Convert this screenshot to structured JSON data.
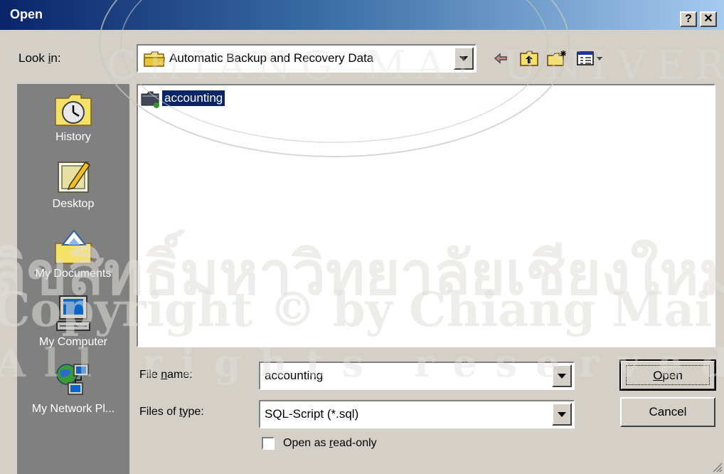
{
  "window": {
    "title": "Open",
    "help_label": "?",
    "close_label": "✕"
  },
  "lookin": {
    "label_pre": "Look ",
    "label_u": "i",
    "label_post": "n:",
    "value": "Automatic Backup and Recovery Data"
  },
  "toolbar": {
    "back_icon": "back-arrow-icon",
    "up_icon": "up-folder-icon",
    "newfolder_icon": "new-folder-icon",
    "view_icon": "view-menu-icon"
  },
  "places": [
    {
      "label": "History",
      "icon": "history-icon"
    },
    {
      "label": "Desktop",
      "icon": "desktop-icon"
    },
    {
      "label": "My Documents",
      "icon": "my-documents-icon"
    },
    {
      "label": "My Computer",
      "icon": "my-computer-icon"
    },
    {
      "label": "My Network Pl...",
      "icon": "my-network-places-icon"
    }
  ],
  "files": [
    {
      "name": "accounting",
      "icon": "database-folder-icon",
      "selected": true
    }
  ],
  "filename": {
    "label_pre": "File ",
    "label_u": "n",
    "label_post": "ame:",
    "value": "accounting"
  },
  "filetype": {
    "label_pre": "Files of ",
    "label_u": "t",
    "label_post": "ype:",
    "value": "SQL-Script (*.sql)"
  },
  "readonly": {
    "label_pre": "Open as ",
    "label_u": "r",
    "label_post": "ead-only",
    "checked": false
  },
  "buttons": {
    "open_u": "O",
    "open_post": "pen",
    "cancel": "Cancel"
  },
  "watermark": {
    "line1": "ลิขสิทธิ์มหาวิทยาลัยเชียงใหม่",
    "line2": "Copyright © by Chiang Mai University",
    "line3": "All rights reserved",
    "arc": "CHIANG MAI UNIVERSITY"
  }
}
